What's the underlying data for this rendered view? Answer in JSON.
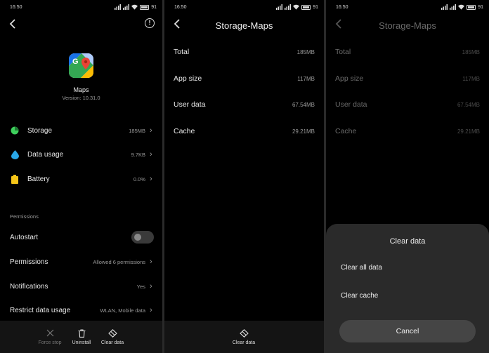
{
  "status_bar": {
    "time": "16:50",
    "battery": "91"
  },
  "panel1": {
    "app_name": "Maps",
    "version": "Version: 10.31.0",
    "items": [
      {
        "label": "Storage",
        "value": "185MB"
      },
      {
        "label": "Data usage",
        "value": "9.7KB"
      },
      {
        "label": "Battery",
        "value": "0.0%"
      }
    ],
    "permissions_header": "Permissions",
    "perm_items": [
      {
        "label": "Autostart",
        "value": ""
      },
      {
        "label": "Permissions",
        "value": "Allowed 6 permissions"
      },
      {
        "label": "Notifications",
        "value": "Yes"
      },
      {
        "label": "Restrict data usage",
        "value": "WLAN, Mobile data"
      }
    ],
    "bottom": {
      "force_stop": "Force stop",
      "uninstall": "Uninstall",
      "clear_data": "Clear data"
    },
    "colors": {
      "storage_icon": "#3ecf5c",
      "data_icon": "#29a7e8",
      "battery_icon": "#f5c518"
    }
  },
  "panel2": {
    "title": "Storage-Maps",
    "rows": [
      {
        "label": "Total",
        "value": "185MB"
      },
      {
        "label": "App size",
        "value": "117MB"
      },
      {
        "label": "User data",
        "value": "67.54MB"
      },
      {
        "label": "Cache",
        "value": "29.21MB"
      }
    ],
    "bottom": {
      "clear_data": "Clear data"
    }
  },
  "panel3": {
    "title": "Storage-Maps",
    "rows": [
      {
        "label": "Total",
        "value": "185MB"
      },
      {
        "label": "App size",
        "value": "117MB"
      },
      {
        "label": "User data",
        "value": "67.54MB"
      },
      {
        "label": "Cache",
        "value": "29.21MB"
      }
    ],
    "sheet": {
      "title": "Clear data",
      "clear_all": "Clear all data",
      "clear_cache": "Clear cache",
      "cancel": "Cancel"
    }
  }
}
